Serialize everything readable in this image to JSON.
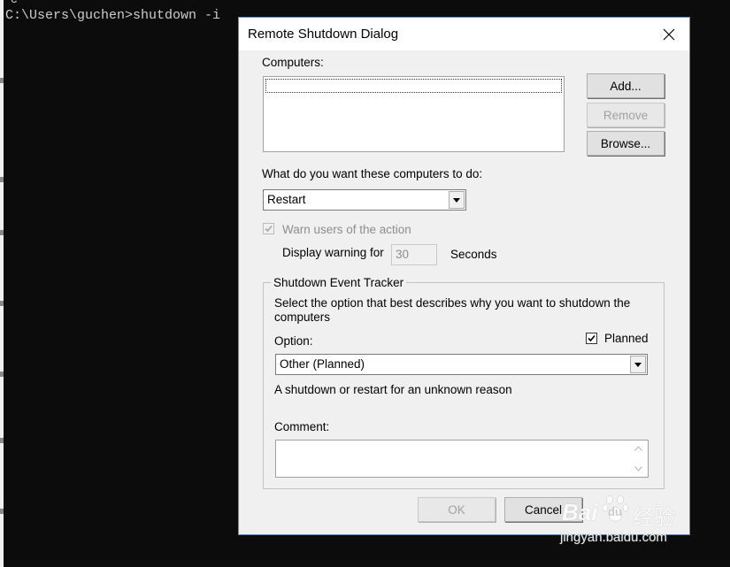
{
  "console": {
    "top_fragment": "c",
    "command_line": "C:\\Users\\guchen>shutdown -i"
  },
  "dialog": {
    "title": "Remote Shutdown Dialog",
    "computers_label": "Computers:",
    "buttons": {
      "add": "Add...",
      "remove": "Remove",
      "browse": "Browse..."
    },
    "action_label": "What do you want these computers to do:",
    "action_value": "Restart",
    "warn_label": "Warn users of the action",
    "display_warning_label": "Display warning for",
    "display_warning_value": "30",
    "seconds_label": "Seconds",
    "tracker": {
      "legend": "Shutdown Event Tracker",
      "description": "Select the option that best describes why you want to shutdown the computers",
      "option_label": "Option:",
      "planned_label": "Planned",
      "option_value": "Other (Planned)",
      "reason": "A shutdown or restart for an unknown reason",
      "comment_label": "Comment:"
    },
    "ok": "OK",
    "cancel": "Cancel"
  },
  "watermark": {
    "brand": "Bai",
    "brand2": "du",
    "cn": "经验",
    "url": "jingyan.baidu.com"
  }
}
